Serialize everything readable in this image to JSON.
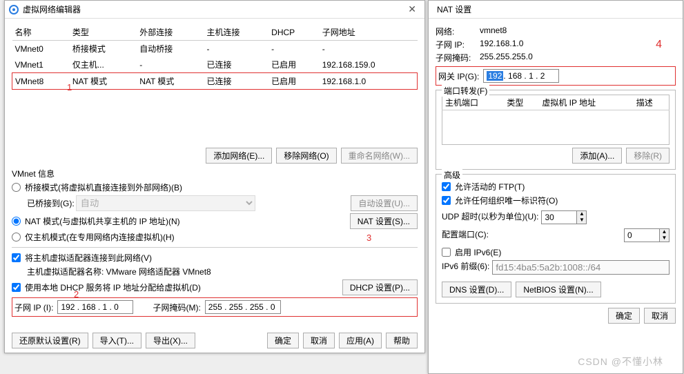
{
  "left": {
    "title": "虚拟网络编辑器",
    "headers": [
      "名称",
      "类型",
      "外部连接",
      "主机连接",
      "DHCP",
      "子网地址"
    ],
    "rows": [
      {
        "name": "VMnet0",
        "type": "桥接模式",
        "ext": "自动桥接",
        "host": "-",
        "dhcp": "-",
        "subnet": "-"
      },
      {
        "name": "VMnet1",
        "type": "仅主机...",
        "ext": "-",
        "host": "已连接",
        "dhcp": "已启用",
        "subnet": "192.168.159.0"
      },
      {
        "name": "VMnet8",
        "type": "NAT 模式",
        "ext": "NAT 模式",
        "host": "已连接",
        "dhcp": "已启用",
        "subnet": "192.168.1.0"
      }
    ],
    "addNet": "添加网络(E)...",
    "removeNet": "移除网络(O)",
    "renameNet": "重命名网络(W)...",
    "vmnetInfo": "VMnet 信息",
    "radioBridge": "桥接模式(将虚拟机直接连接到外部网络)(B)",
    "bridgeToLabel": "已桥接到(G):",
    "bridgeToValue": "自动",
    "autoSetBtn": "自动设置(U)...",
    "radioNat": "NAT 模式(与虚拟机共享主机的 IP 地址)(N)",
    "natSetBtn": "NAT 设置(S)...",
    "radioHost": "仅主机模式(在专用网络内连接虚拟机)(H)",
    "chkConnect": "将主机虚拟适配器连接到此网络(V)",
    "adapterName": "主机虚拟适配器名称: VMware 网络适配器 VMnet8",
    "chkDhcp": "使用本地 DHCP 服务将 IP 地址分配给虚拟机(D)",
    "dhcpSetBtn": "DHCP 设置(P)...",
    "subnetIpLabel": "子网 IP (I):",
    "subnetIpValue": "192 . 168 .  1  .  0",
    "subnetMaskLabel": "子网掩码(M):",
    "subnetMaskValue": "255 . 255 . 255 .  0",
    "restore": "还原默认设置(R)",
    "import": "导入(T)...",
    "export": "导出(X)...",
    "ok": "确定",
    "cancel": "取消",
    "apply": "应用(A)",
    "help": "帮助"
  },
  "right": {
    "title": "NAT 设置",
    "netLabel": "网络:",
    "netValue": "vmnet8",
    "subnetIpLabel": "子网 IP:",
    "subnetIpValue": "192.168.1.0",
    "subnetMaskLabel": "子网掩码:",
    "subnetMaskValue": "255.255.255.0",
    "gatewayLabel": "网关 IP(G):",
    "gatewaySelected": "192",
    "gatewayRest": " . 168 .  1  .  2",
    "portFwd": "端口转发(F)",
    "pfHeaders": [
      "主机端口",
      "类型",
      "虚拟机 IP 地址",
      "描述"
    ],
    "addBtn": "添加(A)...",
    "removeBtn": "移除(R)",
    "advanced": "高级",
    "allowFtp": "允许活动的 FTP(T)",
    "allowOui": "允许任何组织唯一标识符(O)",
    "udpTimeoutLabel": "UDP 超时(以秒为单位)(U):",
    "udpTimeoutValue": "30",
    "configPortLabel": "配置端口(C):",
    "configPortValue": "0",
    "enableIpv6": "启用 IPv6(E)",
    "ipv6PrefixLabel": "IPv6 前缀(6):",
    "ipv6PrefixValue": "fd15:4ba5:5a2b:1008::/64",
    "dnsBtn": "DNS 设置(D)...",
    "netbiosBtn": "NetBIOS 设置(N)...",
    "ok": "确定",
    "cancel": "取消"
  },
  "anno": {
    "a1": "1",
    "a2": "2",
    "a3": "3",
    "a4": "4"
  },
  "watermark": "CSDN @不懂小林"
}
